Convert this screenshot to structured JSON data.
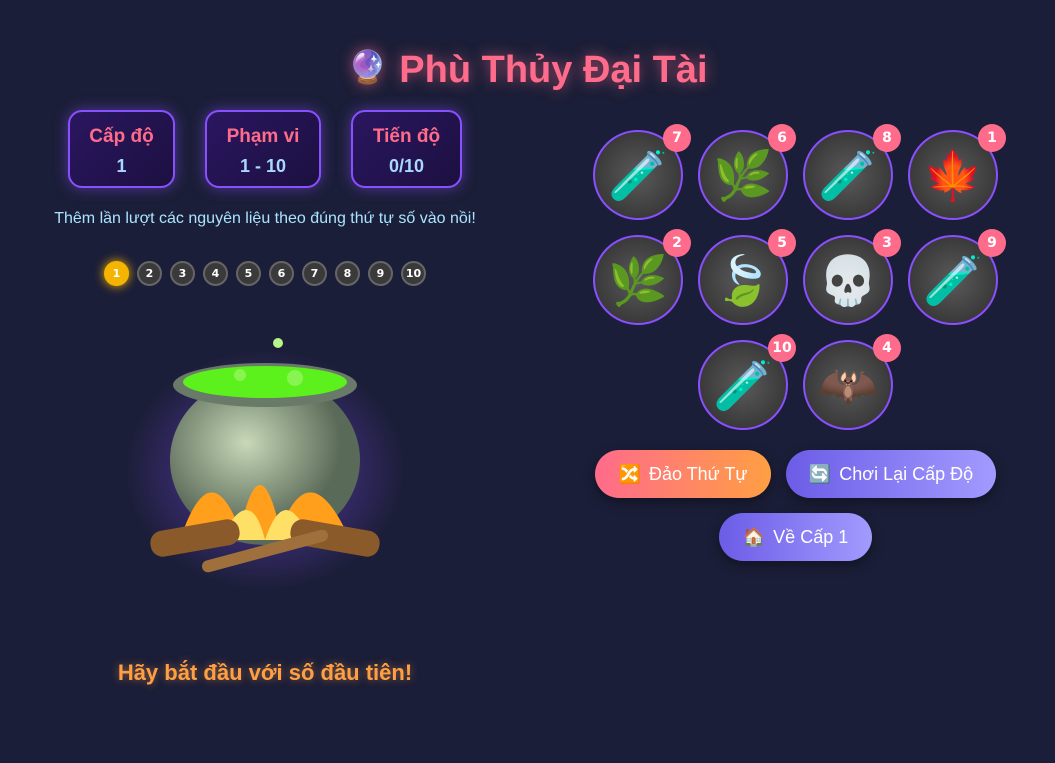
{
  "title": "Phù Thủy Đại Tài",
  "title_icon": "🔮",
  "stats": [
    {
      "label": "Cấp độ",
      "value": "1"
    },
    {
      "label": "Phạm vi",
      "value": "1 - 10"
    },
    {
      "label": "Tiến độ",
      "value": "0/10"
    }
  ],
  "instruction": "Thêm lần lượt các nguyên liệu theo đúng thứ tự số vào nồi!",
  "steps": [
    "1",
    "2",
    "3",
    "4",
    "5",
    "6",
    "7",
    "8",
    "9",
    "10"
  ],
  "active_step": "1",
  "message": "Hãy bắt đầu với số đầu tiên!",
  "ingredients": [
    {
      "number": "7",
      "icon": "🧪",
      "name": "orange-potion"
    },
    {
      "number": "6",
      "icon": "🌿",
      "name": "fern"
    },
    {
      "number": "8",
      "icon": "🧪",
      "name": "purple-potion"
    },
    {
      "number": "1",
      "icon": "🍁",
      "name": "green-leaf"
    },
    {
      "number": "2",
      "icon": "🌿",
      "name": "herb-sprig"
    },
    {
      "number": "5",
      "icon": "🍃",
      "name": "monstera-leaf"
    },
    {
      "number": "3",
      "icon": "💀",
      "name": "skull"
    },
    {
      "number": "9",
      "icon": "🧪",
      "name": "green-potion"
    },
    {
      "number": "10",
      "icon": "🧪",
      "name": "dark-potion"
    },
    {
      "number": "4",
      "icon": "🦇",
      "name": "bat"
    }
  ],
  "buttons": {
    "shuffle": {
      "icon": "🔀",
      "label": "Đảo Thứ Tự"
    },
    "replay": {
      "icon": "🔄",
      "label": "Chơi Lại Cấp Độ"
    },
    "home": {
      "icon": "🏠",
      "label": "Về Cấp 1"
    }
  },
  "colors": {
    "background": "#1b1e38",
    "accent": "#ff6b8b",
    "border": "#8a4fff",
    "active_step": "#f5b400"
  }
}
